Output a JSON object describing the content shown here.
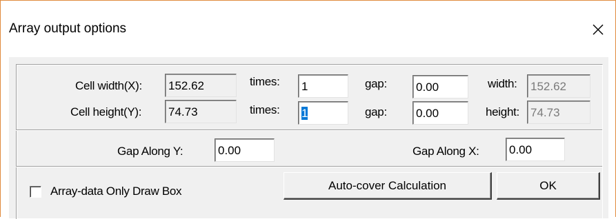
{
  "window": {
    "title": "Array output options",
    "close_icon": "close-icon"
  },
  "cell_width": {
    "label": "Cell width(X):",
    "value": "152.62",
    "times_label": "times:",
    "times_value": "1",
    "gap_label": "gap:",
    "gap_value": "0.00",
    "total_label": "width:",
    "total_value": "152.62"
  },
  "cell_height": {
    "label": "Cell height(Y):",
    "value": "74.73",
    "times_label": "times:",
    "times_value": "1",
    "gap_label": "gap:",
    "gap_value": "0.00",
    "total_label": "height:",
    "total_value": "74.73"
  },
  "gap_along_y": {
    "label": "Gap Along Y:",
    "value": "0.00"
  },
  "gap_along_x": {
    "label": "Gap Along X:",
    "value": "0.00"
  },
  "draw_box": {
    "label": "Array-data Only Draw Box",
    "checked": false
  },
  "buttons": {
    "auto_cover": "Auto-cover Calculation",
    "ok": "OK"
  }
}
